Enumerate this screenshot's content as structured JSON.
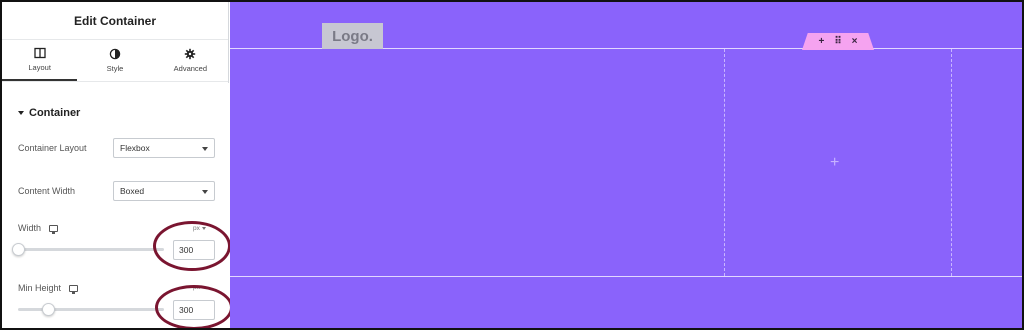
{
  "panel": {
    "title": "Edit Container",
    "tabs": [
      {
        "label": "Layout",
        "icon": "layout-icon",
        "active": true
      },
      {
        "label": "Style",
        "icon": "contrast-icon",
        "active": false
      },
      {
        "label": "Advanced",
        "icon": "gear-icon",
        "active": false
      }
    ]
  },
  "section": {
    "title": "Container",
    "container_layout": {
      "label": "Container Layout",
      "value": "Flexbox"
    },
    "content_width": {
      "label": "Content Width",
      "value": "Boxed"
    },
    "width": {
      "label": "Width",
      "unit": "px",
      "value": "300",
      "device_icon": "monitor-icon"
    },
    "min_height": {
      "label": "Min Height",
      "unit": "px",
      "value": "300",
      "device_icon": "monitor-icon"
    }
  },
  "canvas": {
    "logo_text": "Logo.",
    "handle": {
      "add": "+",
      "move": "⠿",
      "close": "×"
    },
    "add_glyph": "+",
    "background": "#8a63fb"
  },
  "colors": {
    "accent_circle": "#7a1530",
    "handle": "#f5a3f0"
  }
}
